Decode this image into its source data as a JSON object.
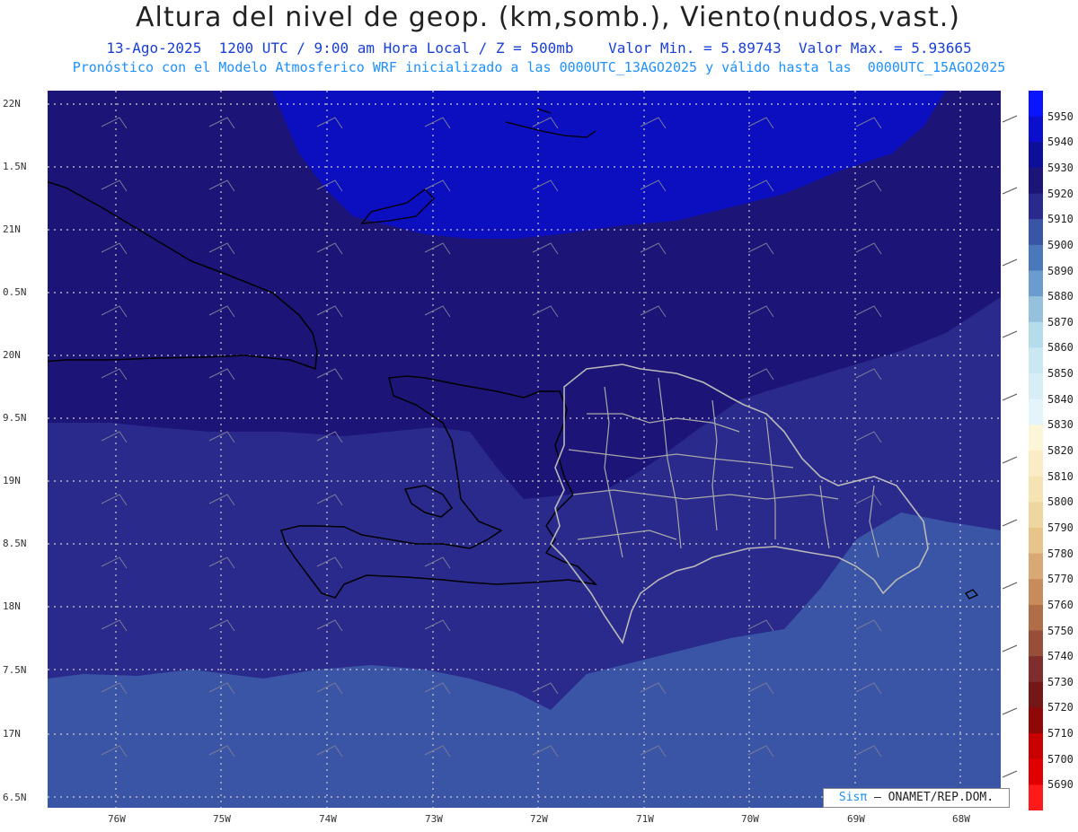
{
  "title": "Altura del nivel de geop. (km,somb.), Viento(nudos,vast.)",
  "subtitle_line1": "13-Ago-2025  1200 UTC / 9:00 am Hora Local / Z = 500mb    Valor Min. = 5.89743  Valor Max. = 5.93665",
  "subtitle_line2": "Pronóstico con el Modelo Atmosferico WRF inicializado a las 0000UTC_13AGO2025 y válido hasta las  0000UTC_15AGO2025",
  "y_ticks": [
    "22N",
    "1.5N",
    "21N",
    "0.5N",
    "20N",
    "9.5N",
    "19N",
    "8.5N",
    "18N",
    "7.5N",
    "17N",
    "6.5N"
  ],
  "x_ticks": [
    "76W",
    "75W",
    "74W",
    "73W",
    "72W",
    "71W",
    "70W",
    "69W",
    "68W"
  ],
  "colorbar": {
    "levels": [
      "5950",
      "5940",
      "5930",
      "5920",
      "5910",
      "5900",
      "5890",
      "5880",
      "5870",
      "5860",
      "5850",
      "5840",
      "5830",
      "5820",
      "5810",
      "5800",
      "5790",
      "5780",
      "5770",
      "5760",
      "5750",
      "5740",
      "5730",
      "5720",
      "5710",
      "5700",
      "5690"
    ],
    "colors": [
      "#0a14ff",
      "#0b0fcc",
      "#0d0f99",
      "#1c1577",
      "#2a2a8c",
      "#3a55a6",
      "#4a78bb",
      "#6b9ccd",
      "#95c1dc",
      "#b4dceb",
      "#c9e8f2",
      "#d7eef7",
      "#e3f4fb",
      "#fdf5d8",
      "#faedc5",
      "#f5e3b4",
      "#eed6a0",
      "#e6c48a",
      "#d8a974",
      "#c88c5c",
      "#b06e48",
      "#984f3a",
      "#7f2d2d",
      "#741717",
      "#8f0808",
      "#c80000",
      "#e00000",
      "#ff1a1a"
    ]
  },
  "credit": {
    "prefix": "Sisπ",
    "text": "– ONAMET/REP.DOM."
  }
}
